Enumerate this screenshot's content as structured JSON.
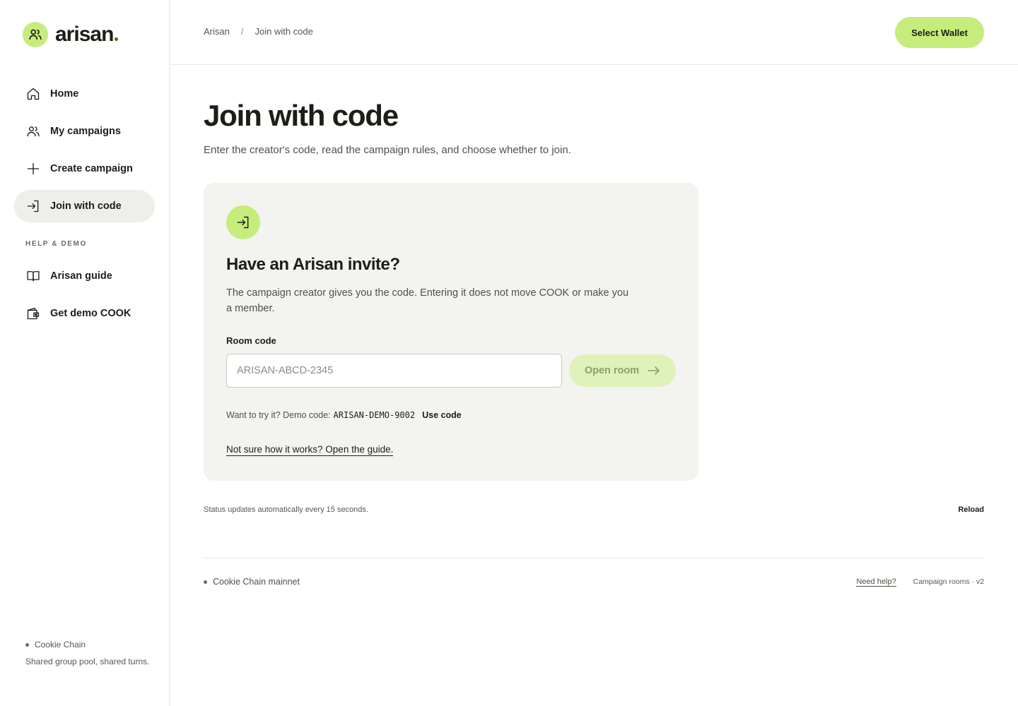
{
  "brand": {
    "name": "arisan"
  },
  "colors": {
    "accent": "#c6ec7c",
    "accent_muted": "#dff2b9",
    "text": "#1c1f17",
    "card_bg": "#f3f3ef"
  },
  "sidebar": {
    "items": [
      {
        "label": "Home",
        "icon": "home-icon"
      },
      {
        "label": "My campaigns",
        "icon": "users-icon"
      },
      {
        "label": "Create campaign",
        "icon": "plus-icon"
      },
      {
        "label": "Join with code",
        "icon": "login-icon",
        "active": true
      }
    ],
    "section_label": "HELP & DEMO",
    "help_items": [
      {
        "label": "Arisan guide",
        "icon": "book-icon"
      },
      {
        "label": "Get demo COOK",
        "icon": "wallet-icon"
      }
    ],
    "footer": {
      "chain": "Cookie Chain",
      "description": "Shared group pool, shared turns."
    }
  },
  "header": {
    "breadcrumb": [
      "Arisan",
      "Join with code"
    ],
    "breadcrumb_separator": "/",
    "wallet_button": "Select Wallet"
  },
  "main": {
    "title": "Join with code",
    "subtitle": "Enter the creator's code, read the campaign rules, and choose whether to join.",
    "card": {
      "icon": "login-icon",
      "title": "Have an Arisan invite?",
      "description": "The campaign creator gives you the code. Entering it does not move COOK or make you a member.",
      "field_label": "Room code",
      "input_value": "",
      "input_placeholder": "ARISAN-ABCD-2345",
      "open_button": "Open room",
      "demo_prefix": "Want to try it? Demo code:",
      "demo_code": "ARISAN-DEMO-9002",
      "use_code": "Use code",
      "guide_link": "Not sure how it works? Open the guide."
    },
    "status_text": "Status updates automatically every 15 seconds.",
    "reload": "Reload"
  },
  "footer": {
    "network": "Cookie Chain mainnet",
    "help": "Need help?",
    "version": "Campaign rooms · v2"
  }
}
